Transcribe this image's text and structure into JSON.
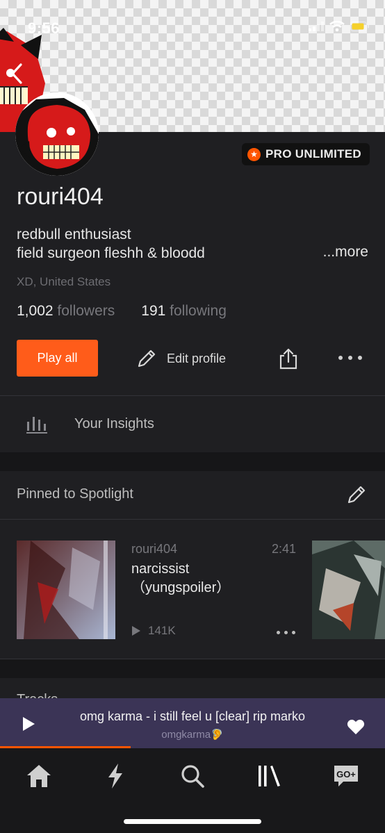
{
  "status_bar": {
    "time": "9:56"
  },
  "profile": {
    "username": "rouri404",
    "badge": "PRO UNLIMITED",
    "bio_line1": "redbull enthusiast",
    "bio_line2": "field surgeon fleshh & bloodd",
    "more": "...more",
    "location": "XD, United States",
    "followers_count": "1,002",
    "followers_label": "followers",
    "following_count": "191",
    "following_label": "following"
  },
  "actions": {
    "play_all": "Play all",
    "edit_profile": "Edit profile"
  },
  "insights": {
    "label": "Your Insights"
  },
  "spotlight": {
    "title": "Pinned to Spotlight",
    "track": {
      "user": "rouri404",
      "duration": "2:41",
      "title": "narcissist （yungspoiler）",
      "plays": "141K"
    }
  },
  "next_section": {
    "title": "Tracks"
  },
  "player": {
    "title": "omg karma - i still feel u [clear] rip marko",
    "artist": "omgkarma🦻",
    "progress": 0.34
  },
  "tabbar": {
    "items": [
      "home-icon",
      "stream-icon",
      "search-icon",
      "library-icon",
      "go-plus-icon"
    ],
    "go_label": "GO+"
  },
  "colors": {
    "accent": "#ff5500",
    "background": "#1f1f22",
    "player": "#3b3456"
  }
}
